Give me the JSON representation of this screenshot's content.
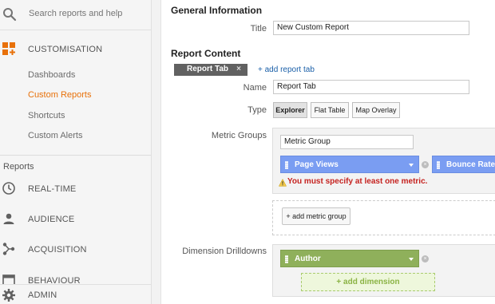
{
  "sidebar": {
    "search_placeholder": "Search reports and help",
    "customisation": {
      "label": "CUSTOMISATION",
      "items": [
        {
          "label": "Dashboards",
          "active": false
        },
        {
          "label": "Custom Reports",
          "active": true
        },
        {
          "label": "Shortcuts",
          "active": false
        },
        {
          "label": "Custom Alerts",
          "active": false
        }
      ]
    },
    "reports_label": "Reports",
    "nav": [
      {
        "label": "REAL-TIME",
        "icon": "clock-icon"
      },
      {
        "label": "AUDIENCE",
        "icon": "person-icon"
      },
      {
        "label": "ACQUISITION",
        "icon": "acquisition-icon"
      },
      {
        "label": "BEHAVIOUR",
        "icon": "behaviour-icon"
      },
      {
        "label": "ADMIN",
        "icon": "gear-icon"
      }
    ],
    "accent_color": "#e8710a"
  },
  "general": {
    "heading": "General Information",
    "title_label": "Title",
    "title_value": "New Custom Report"
  },
  "content": {
    "heading": "Report Content",
    "tab_label": "Report Tab",
    "tab_close": "×",
    "add_tab_link": "+ add report tab",
    "name_label": "Name",
    "name_value": "Report Tab",
    "type_label": "Type",
    "types": [
      "Explorer",
      "Flat Table",
      "Map Overlay"
    ],
    "selected_type": "Explorer",
    "metric_groups_label": "Metric Groups",
    "metric_group_name": "Metric Group",
    "metrics": [
      "Page Views",
      "Bounce Rate"
    ],
    "warning": "You must specify at least one metric.",
    "add_metric_group": "+ add metric group",
    "dimension_label": "Dimension Drilldowns",
    "dimension": "Author",
    "add_dimension": "+ add dimension"
  }
}
